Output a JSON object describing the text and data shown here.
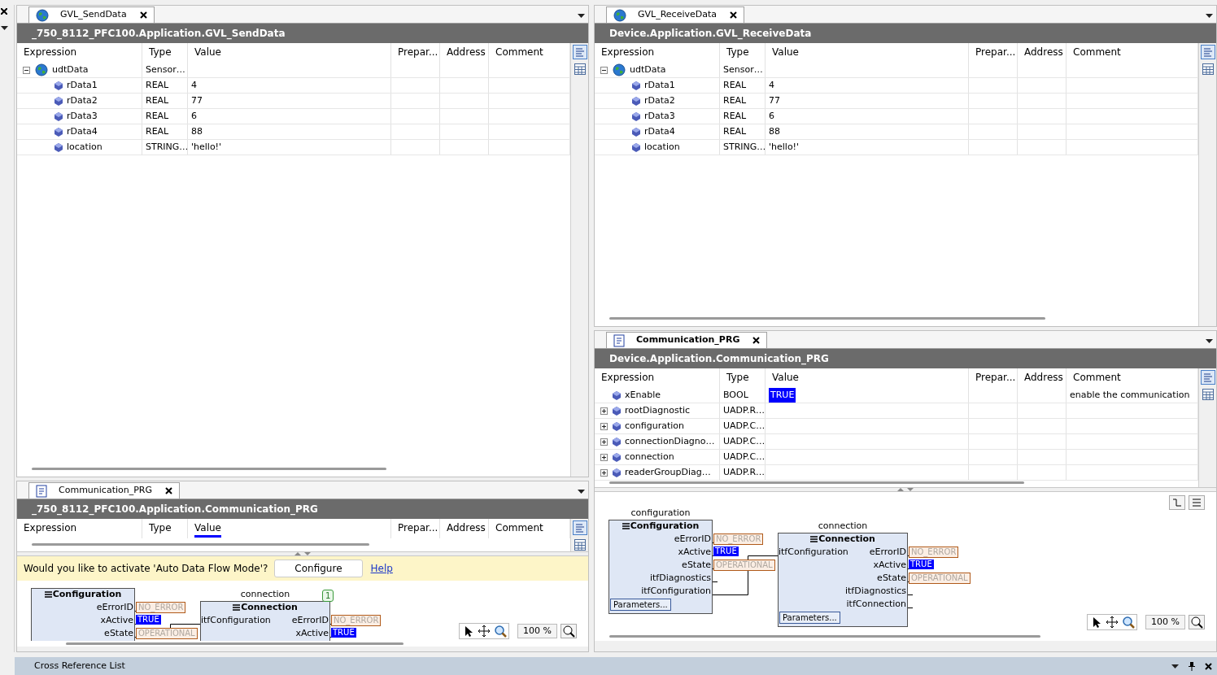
{
  "left": {
    "upper": {
      "tab": {
        "label": "GVL_SendData",
        "kind": "gvl",
        "selected": false
      },
      "path": "_750_8112_PFC100.Application.GVL_SendData",
      "columns": [
        {
          "label": "Expression",
          "sorted": false
        },
        {
          "label": "Type",
          "sorted": false
        },
        {
          "label": "Value",
          "sorted": false
        },
        {
          "label": "Prepar...",
          "sorted": false
        },
        {
          "label": "Address",
          "sorted": false
        },
        {
          "label": "Comment",
          "sorted": false
        }
      ],
      "rows": [
        {
          "expression": "udtData",
          "type": "Sensor…",
          "kind": "structure",
          "expanded": true,
          "children": [
            {
              "expression": "rData1",
              "type": "REAL",
              "value": "4",
              "kind": "variable",
              "highlighted": false
            },
            {
              "expression": "rData2",
              "type": "REAL",
              "value": "77",
              "kind": "variable",
              "highlighted": false
            },
            {
              "expression": "rData3",
              "type": "REAL",
              "value": "6",
              "kind": "variable",
              "highlighted": false
            },
            {
              "expression": "rData4",
              "type": "REAL",
              "value": "88",
              "kind": "variable",
              "highlighted": false
            },
            {
              "expression": "location",
              "type": "STRING…",
              "value": "'hello!'",
              "kind": "variable",
              "highlighted": false
            }
          ]
        }
      ]
    },
    "lower": {
      "tab": {
        "label": "Communication_PRG",
        "kind": "program",
        "selected": false
      },
      "path": "_750_8112_PFC100.Application.Communication_PRG",
      "columns": [
        {
          "label": "Expression",
          "sorted": false
        },
        {
          "label": "Type",
          "sorted": false
        },
        {
          "label": "Value",
          "sorted": true
        },
        {
          "label": "Prepar...",
          "sorted": false
        },
        {
          "label": "Address",
          "sorted": false
        },
        {
          "label": "Comment",
          "sorted": false
        }
      ],
      "notice": {
        "message": "Would you like to activate 'Auto Data Flow Mode'?",
        "button": "Configure",
        "link": "Help"
      },
      "fbd": {
        "zoom": "100 %",
        "blocks": [
          {
            "type": "Configuration",
            "outputs": [
              {
                "name": "eErrorID",
                "value": "NO_ERROR",
                "kind": "enum"
              },
              {
                "name": "xActive",
                "value": "TRUE",
                "kind": "bool"
              },
              {
                "name": "eState",
                "value": "OPERATIONAL",
                "kind": "enum"
              }
            ]
          },
          {
            "instance": "connection",
            "type": "Connection",
            "badge": "1",
            "inputs": [
              "itfConfiguration"
            ],
            "outputs": [
              {
                "name": "eErrorID",
                "value": "NO_ERROR",
                "kind": "enum"
              },
              {
                "name": "xActive",
                "value": "TRUE",
                "kind": "bool"
              }
            ]
          }
        ]
      }
    }
  },
  "right": {
    "upper": {
      "tab": {
        "label": "GVL_ReceiveData",
        "kind": "gvl",
        "selected": false
      },
      "path": "Device.Application.GVL_ReceiveData",
      "columns": [
        {
          "label": "Expression",
          "sorted": false
        },
        {
          "label": "Type",
          "sorted": false
        },
        {
          "label": "Value",
          "sorted": false
        },
        {
          "label": "Prepar...",
          "sorted": false
        },
        {
          "label": "Address",
          "sorted": false
        },
        {
          "label": "Comment",
          "sorted": false
        }
      ],
      "rows": [
        {
          "expression": "udtData",
          "type": "Sensor…",
          "kind": "structure",
          "expanded": true,
          "children": [
            {
              "expression": "rData1",
              "type": "REAL",
              "value": "4",
              "kind": "variable",
              "highlighted": false
            },
            {
              "expression": "rData2",
              "type": "REAL",
              "value": "77",
              "kind": "variable",
              "highlighted": false
            },
            {
              "expression": "rData3",
              "type": "REAL",
              "value": "6",
              "kind": "variable",
              "highlighted": false
            },
            {
              "expression": "rData4",
              "type": "REAL",
              "value": "88",
              "kind": "variable",
              "highlighted": false
            },
            {
              "expression": "location",
              "type": "STRING…",
              "value": "'hello!'",
              "kind": "variable",
              "highlighted": false
            }
          ]
        }
      ]
    },
    "lower": {
      "tab": {
        "label": "Communication_PRG",
        "kind": "program",
        "selected": true
      },
      "path": "Device.Application.Communication_PRG",
      "columns": [
        {
          "label": "Expression",
          "sorted": false
        },
        {
          "label": "Type",
          "sorted": false
        },
        {
          "label": "Value",
          "sorted": false
        },
        {
          "label": "Prepar...",
          "sorted": false
        },
        {
          "label": "Address",
          "sorted": false
        },
        {
          "label": "Comment",
          "sorted": false
        }
      ],
      "rows": [
        {
          "expression": "xEnable",
          "type": "BOOL",
          "value": "TRUE",
          "comment": "enable the communication",
          "kind": "variable",
          "highlighted": true
        },
        {
          "expression": "rootDiagnostic",
          "type": "UADP.R…",
          "kind": "variable",
          "expanded": false
        },
        {
          "expression": "configuration",
          "type": "UADP.C…",
          "kind": "variable",
          "expanded": false
        },
        {
          "expression": "connectionDiagno…",
          "type": "UADP.C…",
          "kind": "variable",
          "expanded": false
        },
        {
          "expression": "connection",
          "type": "UADP.C…",
          "kind": "variable",
          "expanded": false
        },
        {
          "expression": "readerGroupDiag…",
          "type": "UADP.R…",
          "kind": "variable",
          "expanded": false
        }
      ],
      "fbd": {
        "zoom": "100 %",
        "blocks": [
          {
            "instance": "configuration",
            "type": "Configuration",
            "outputs": [
              {
                "name": "eErrorID",
                "value": "NO_ERROR",
                "kind": "enum"
              },
              {
                "name": "xActive",
                "value": "TRUE",
                "kind": "bool"
              },
              {
                "name": "eState",
                "value": "OPERATIONAL",
                "kind": "enum"
              },
              {
                "name": "itfDiagnostics"
              },
              {
                "name": "itfConfiguration"
              }
            ],
            "button": "Parameters..."
          },
          {
            "instance": "connection",
            "type": "Connection",
            "inputs": [
              "itfConfiguration"
            ],
            "outputs": [
              {
                "name": "eErrorID",
                "value": "NO_ERROR",
                "kind": "enum"
              },
              {
                "name": "xActive",
                "value": "TRUE",
                "kind": "bool"
              },
              {
                "name": "eState",
                "value": "OPERATIONAL",
                "kind": "enum"
              },
              {
                "name": "itfDiagnostics"
              },
              {
                "name": "itfConnection"
              }
            ],
            "button": "Parameters..."
          }
        ]
      }
    }
  },
  "bottom_panel": {
    "title": "Cross Reference List"
  }
}
